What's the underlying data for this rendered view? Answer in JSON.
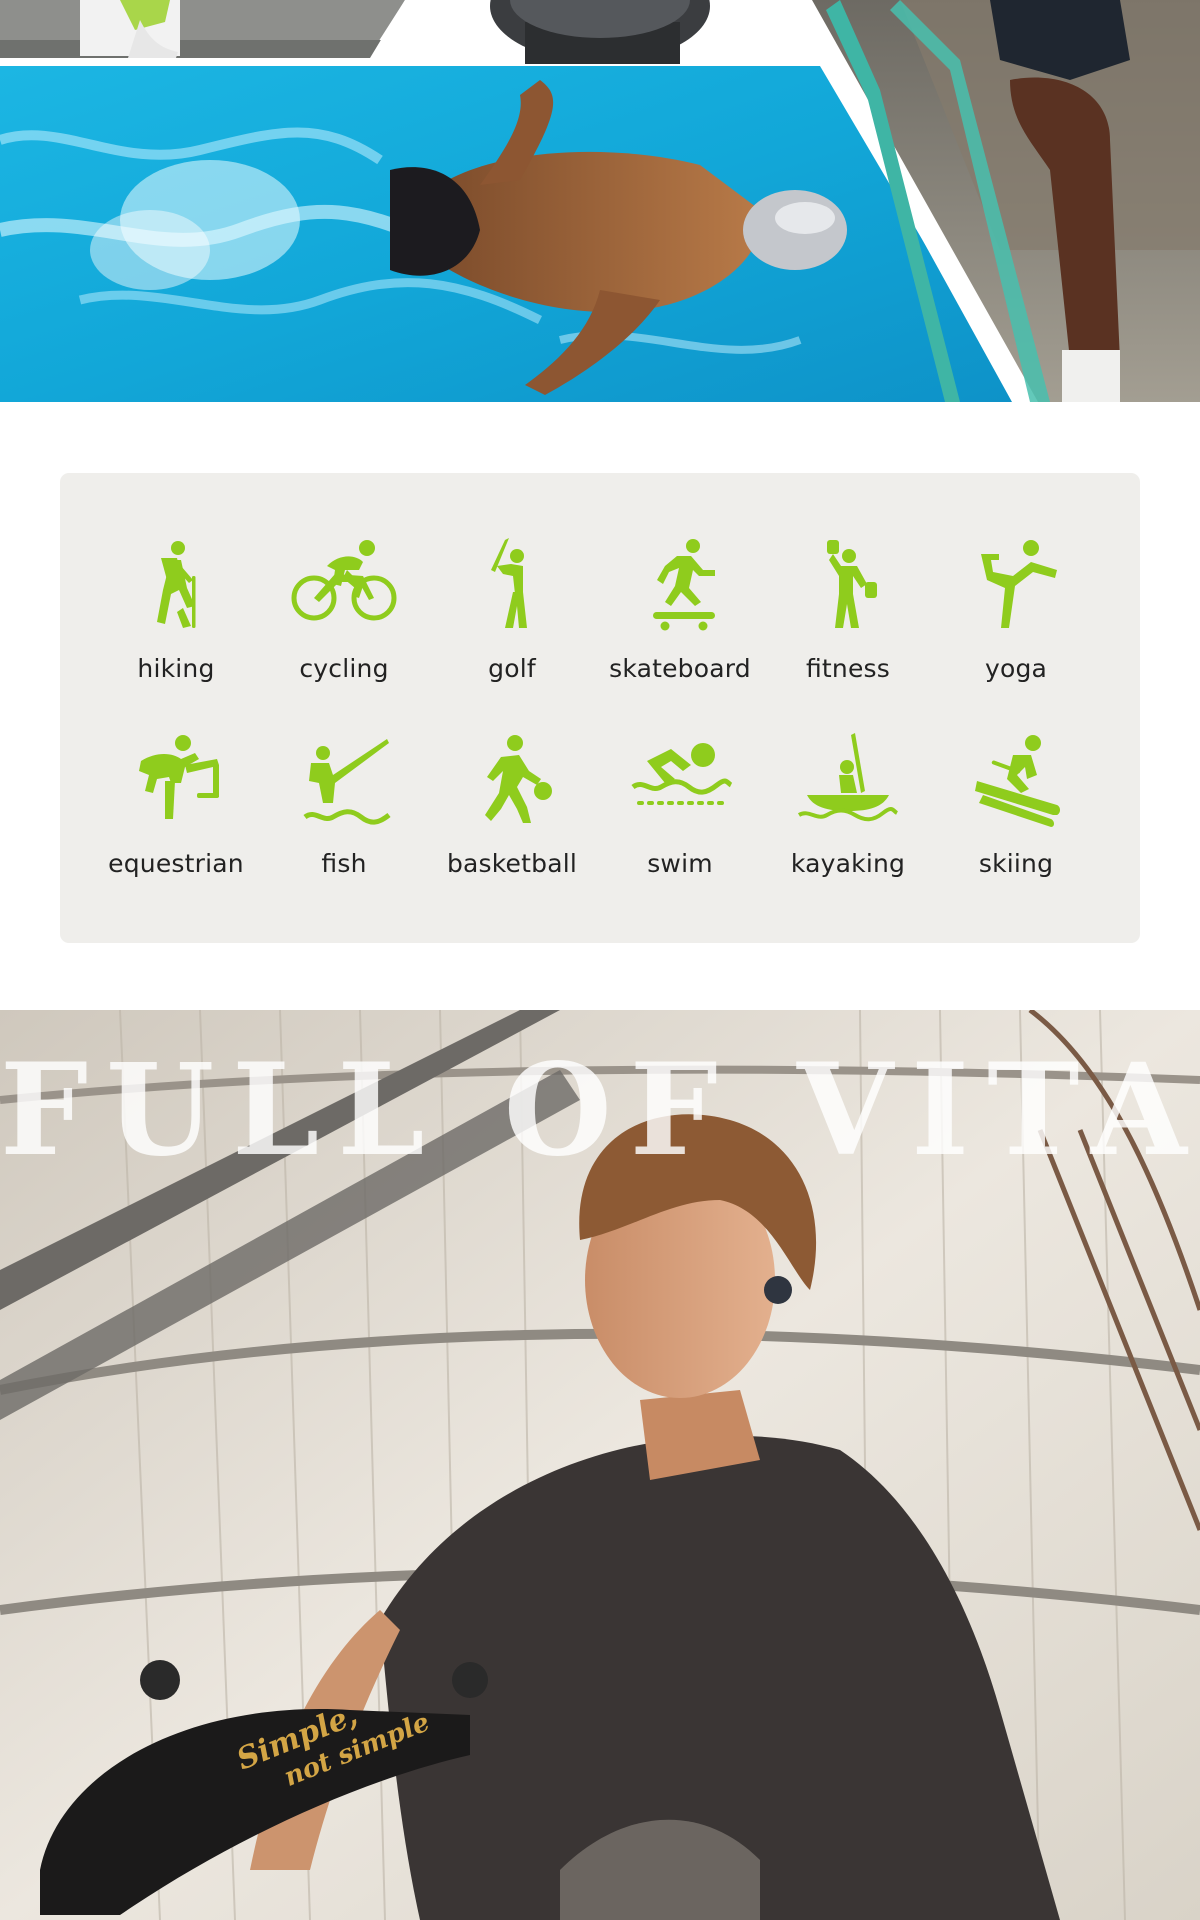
{
  "accent_color": "#8fcc1d",
  "hero": {
    "photos": [
      "running-shoe-photo",
      "smartwatch-photo",
      "swimmer-photo",
      "cyclist-photo"
    ]
  },
  "sports_panel": {
    "items": [
      {
        "label": "hiking",
        "icon": "hiking-icon"
      },
      {
        "label": "cycling",
        "icon": "cycling-icon"
      },
      {
        "label": "golf",
        "icon": "golf-icon"
      },
      {
        "label": "skateboard",
        "icon": "skateboard-icon"
      },
      {
        "label": "ﬁtness",
        "icon": "fitness-icon"
      },
      {
        "label": "yoga",
        "icon": "yoga-icon"
      },
      {
        "label": "equestrian",
        "icon": "equestrian-icon"
      },
      {
        "label": "ﬁsh",
        "icon": "fish-icon"
      },
      {
        "label": "basketball",
        "icon": "basketball-icon"
      },
      {
        "label": "swim",
        "icon": "swim-icon"
      },
      {
        "label": "kayaking",
        "icon": "kayaking-icon"
      },
      {
        "label": "skiing",
        "icon": "skiing-icon"
      }
    ]
  },
  "lifestyle": {
    "headline": "FULL OF VITALITY",
    "skateboard_text_line1": "Simple,",
    "skateboard_text_line2": "not simple"
  }
}
